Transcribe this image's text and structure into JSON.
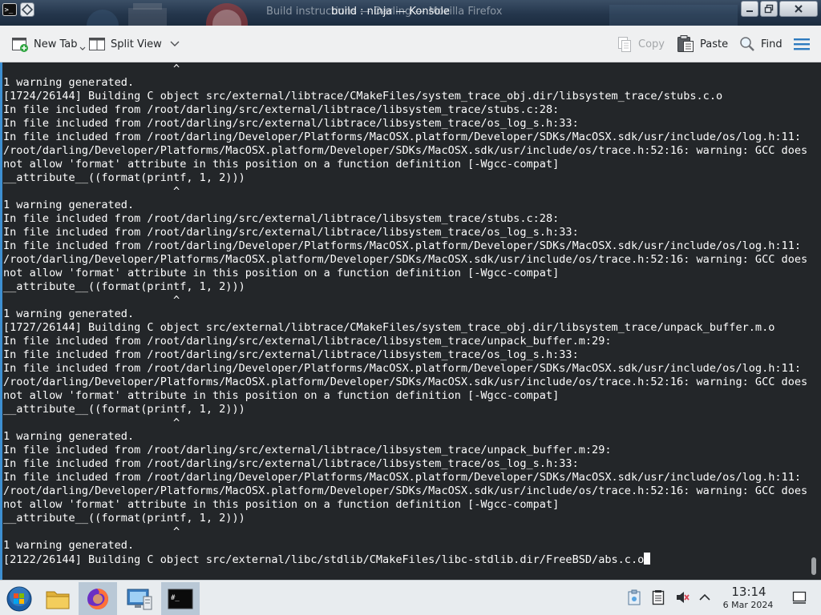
{
  "window": {
    "title_back": "Build instructions — Darling — Mozilla Firefox",
    "title": "build : ninja — Konsole"
  },
  "toolbar": {
    "new_tab_label": "New Tab",
    "split_view_label": "Split View",
    "copy_label": "Copy",
    "paste_label": "Paste",
    "find_label": "Find"
  },
  "terminal": {
    "lines": [
      "                          ^",
      "1 warning generated.",
      "[1724/26144] Building C object src/external/libtrace/CMakeFiles/system_trace_obj.dir/libsystem_trace/stubs.c.o",
      "In file included from /root/darling/src/external/libtrace/libsystem_trace/stubs.c:28:",
      "In file included from /root/darling/src/external/libtrace/libsystem_trace/os_log_s.h:33:",
      "In file included from /root/darling/Developer/Platforms/MacOSX.platform/Developer/SDKs/MacOSX.sdk/usr/include/os/log.h:11:",
      "/root/darling/Developer/Platforms/MacOSX.platform/Developer/SDKs/MacOSX.sdk/usr/include/os/trace.h:52:16: warning: GCC does",
      "not allow 'format' attribute in this position on a function definition [-Wgcc-compat]",
      "__attribute__((format(printf, 1, 2)))",
      "                          ^",
      "1 warning generated.",
      "In file included from /root/darling/src/external/libtrace/libsystem_trace/stubs.c:28:",
      "In file included from /root/darling/src/external/libtrace/libsystem_trace/os_log_s.h:33:",
      "In file included from /root/darling/Developer/Platforms/MacOSX.platform/Developer/SDKs/MacOSX.sdk/usr/include/os/log.h:11:",
      "/root/darling/Developer/Platforms/MacOSX.platform/Developer/SDKs/MacOSX.sdk/usr/include/os/trace.h:52:16: warning: GCC does",
      "not allow 'format' attribute in this position on a function definition [-Wgcc-compat]",
      "__attribute__((format(printf, 1, 2)))",
      "                          ^",
      "1 warning generated.",
      "[1727/26144] Building C object src/external/libtrace/CMakeFiles/system_trace_obj.dir/libsystem_trace/unpack_buffer.m.o",
      "In file included from /root/darling/src/external/libtrace/libsystem_trace/unpack_buffer.m:29:",
      "In file included from /root/darling/src/external/libtrace/libsystem_trace/os_log_s.h:33:",
      "In file included from /root/darling/Developer/Platforms/MacOSX.platform/Developer/SDKs/MacOSX.sdk/usr/include/os/log.h:11:",
      "/root/darling/Developer/Platforms/MacOSX.platform/Developer/SDKs/MacOSX.sdk/usr/include/os/trace.h:52:16: warning: GCC does",
      "not allow 'format' attribute in this position on a function definition [-Wgcc-compat]",
      "__attribute__((format(printf, 1, 2)))",
      "                          ^",
      "1 warning generated.",
      "In file included from /root/darling/src/external/libtrace/libsystem_trace/unpack_buffer.m:29:",
      "In file included from /root/darling/src/external/libtrace/libsystem_trace/os_log_s.h:33:",
      "In file included from /root/darling/Developer/Platforms/MacOSX.platform/Developer/SDKs/MacOSX.sdk/usr/include/os/log.h:11:",
      "/root/darling/Developer/Platforms/MacOSX.platform/Developer/SDKs/MacOSX.sdk/usr/include/os/trace.h:52:16: warning: GCC does",
      "not allow 'format' attribute in this position on a function definition [-Wgcc-compat]",
      "__attribute__((format(printf, 1, 2)))",
      "                          ^",
      "1 warning generated.",
      "[2122/26144] Building C object src/external/libc/stdlib/CMakeFiles/libc-stdlib.dir/FreeBSD/abs.c.o"
    ]
  },
  "taskbar": {
    "clock_time": "13:14",
    "clock_date": "6 Mar 2024",
    "colors": {
      "terminal_bg": "#232629",
      "terminal_fg": "#fcfcfc",
      "accent": "#3d8fd1"
    }
  }
}
